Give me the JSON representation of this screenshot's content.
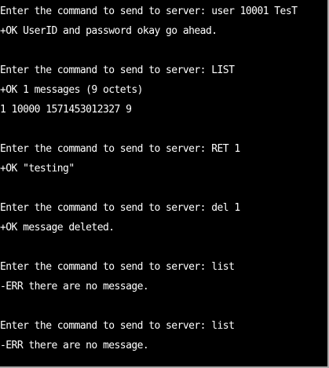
{
  "terminal": {
    "lines": [
      "Enter the command to send to server: user 10001 TesT",
      "+OK UserID and password okay go ahead.",
      "",
      "Enter the command to send to server: LIST",
      "+OK 1 messages (9 octets)",
      "1 10000 1571453012327 9",
      "",
      "Enter the command to send to server: RET 1",
      "+OK \"testing\"",
      "",
      "Enter the command to send to server: del 1",
      "+OK message deleted.",
      "",
      "Enter the command to send to server: list",
      "-ERR there are no message.",
      "",
      "Enter the command to send to server: list",
      "-ERR there are no message."
    ]
  }
}
